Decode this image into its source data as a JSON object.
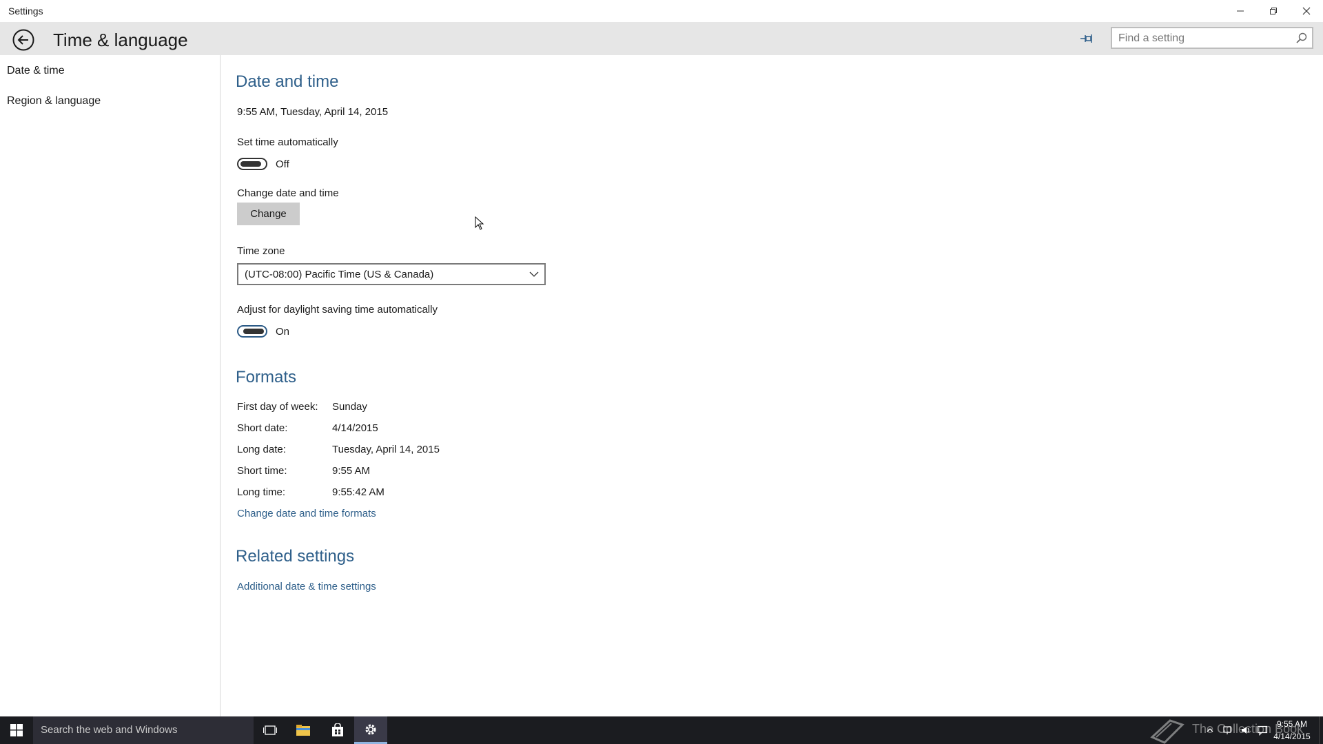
{
  "window": {
    "title": "Settings",
    "controls": {
      "minimize": "minimize",
      "maximize": "restore",
      "close": "close"
    }
  },
  "header": {
    "title": "Time & language",
    "search_placeholder": "Find a setting"
  },
  "sidebar": {
    "items": [
      {
        "label": "Date & time"
      },
      {
        "label": "Region & language"
      }
    ]
  },
  "date_time": {
    "heading": "Date and time",
    "current": "9:55 AM, Tuesday, April 14, 2015",
    "set_auto_label": "Set time automatically",
    "set_auto_state": "Off",
    "change_label": "Change date and time",
    "change_button": "Change",
    "timezone_label": "Time zone",
    "timezone_value": "(UTC-08:00) Pacific Time (US & Canada)",
    "dst_label": "Adjust for daylight saving time automatically",
    "dst_state": "On"
  },
  "formats": {
    "heading": "Formats",
    "rows": [
      {
        "label": "First day of week:",
        "value": "Sunday"
      },
      {
        "label": "Short date:",
        "value": "4/14/2015"
      },
      {
        "label": "Long date:",
        "value": "Tuesday, April 14, 2015"
      },
      {
        "label": "Short time:",
        "value": "9:55 AM"
      },
      {
        "label": "Long time:",
        "value": "9:55:42 AM"
      }
    ],
    "link": "Change date and time formats"
  },
  "related": {
    "heading": "Related settings",
    "link": "Additional date & time settings"
  },
  "taskbar": {
    "search_text": "Search the web and Windows",
    "watermark_text": "The Collection Book",
    "clock_time": "9:55 AM",
    "clock_date": "4/14/2015"
  },
  "colors": {
    "accent": "#2e5f8a",
    "header_bg": "#e6e6e6",
    "taskbar_bg": "#1b1c20"
  }
}
